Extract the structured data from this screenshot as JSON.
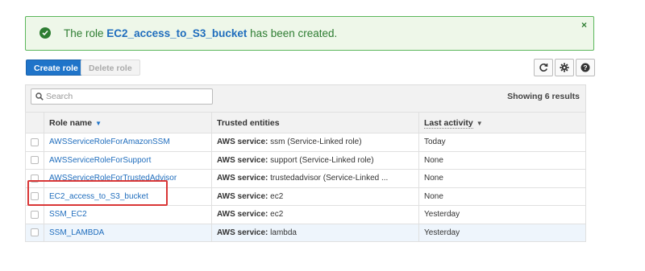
{
  "banner": {
    "prefix": "The role",
    "role_name": "EC2_access_to_S3_bucket",
    "suffix": "has been created.",
    "close_symbol": "×",
    "status_color": "#2e7d32"
  },
  "toolbar": {
    "create_role": "Create role",
    "delete_role": "Delete role",
    "icons": [
      "refresh-icon",
      "gear-icon",
      "help-icon"
    ]
  },
  "search": {
    "placeholder": "Search",
    "value": ""
  },
  "results_text": "Showing 6 results",
  "columns": {
    "role_name": "Role name",
    "trusted": "Trusted entities",
    "last_activity": "Last activity"
  },
  "rows": [
    {
      "name": "AWSServiceRoleForAmazonSSM",
      "service_label": "AWS service:",
      "service": "ssm (Service-Linked role)",
      "activity": "Today"
    },
    {
      "name": "AWSServiceRoleForSupport",
      "service_label": "AWS service:",
      "service": "support (Service-Linked role)",
      "activity": "None"
    },
    {
      "name": "AWSServiceRoleForTrustedAdvisor",
      "service_label": "AWS service:",
      "service": "trustedadvisor (Service-Linked ...",
      "activity": "None"
    },
    {
      "name": "EC2_access_to_S3_bucket",
      "service_label": "AWS service:",
      "service": "ec2",
      "activity": "None"
    },
    {
      "name": "SSM_EC2",
      "service_label": "AWS service:",
      "service": "ec2",
      "activity": "Yesterday"
    },
    {
      "name": "SSM_LAMBDA",
      "service_label": "AWS service:",
      "service": "lambda",
      "activity": "Yesterday"
    }
  ],
  "colors": {
    "accent": "#1f74c9",
    "link": "#1f6dbd",
    "annotation": "#d93636"
  }
}
